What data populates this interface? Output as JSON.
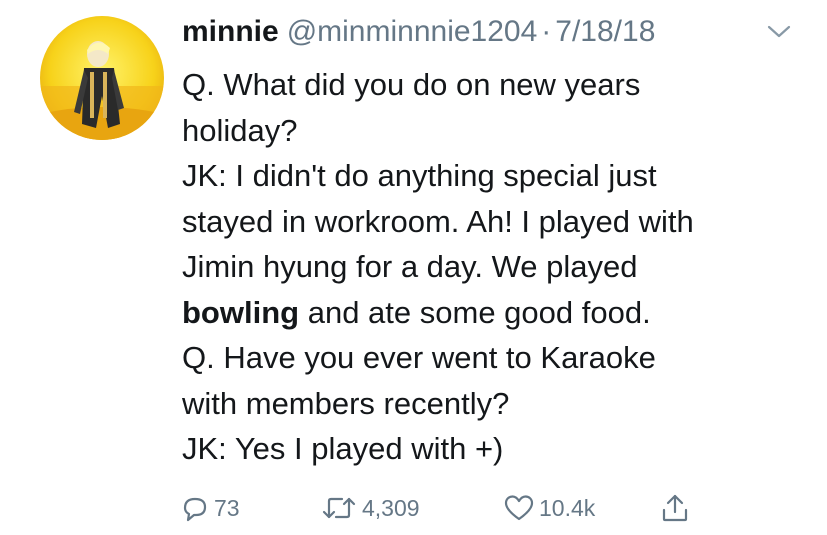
{
  "tweet": {
    "author": {
      "display_name": "minnie",
      "handle": "@minminnnie1204",
      "separator": "·",
      "date": "7/18/18"
    },
    "body_lines": [
      "Q. What did you do on new years",
      "holiday?",
      "JK: I didn't do anything special just",
      "stayed in workroom. Ah! I played with",
      "Jimin hyung for a day. We played"
    ],
    "bold_line": {
      "bold": "bowling",
      "rest": " and ate some good food."
    },
    "body_lines_after": [
      "Q. Have you ever went to Karaoke",
      "with members recently?",
      "JK: Yes I played with +)"
    ],
    "actions": {
      "reply": {
        "icon": "reply-icon",
        "count": "73"
      },
      "retweet": {
        "icon": "retweet-icon",
        "count": "4,309"
      },
      "like": {
        "icon": "heart-icon",
        "count": "10.4k"
      },
      "share": {
        "icon": "share-icon"
      }
    },
    "colors": {
      "text": "#14171a",
      "secondary": "#657786",
      "background": "#ffffff"
    }
  }
}
